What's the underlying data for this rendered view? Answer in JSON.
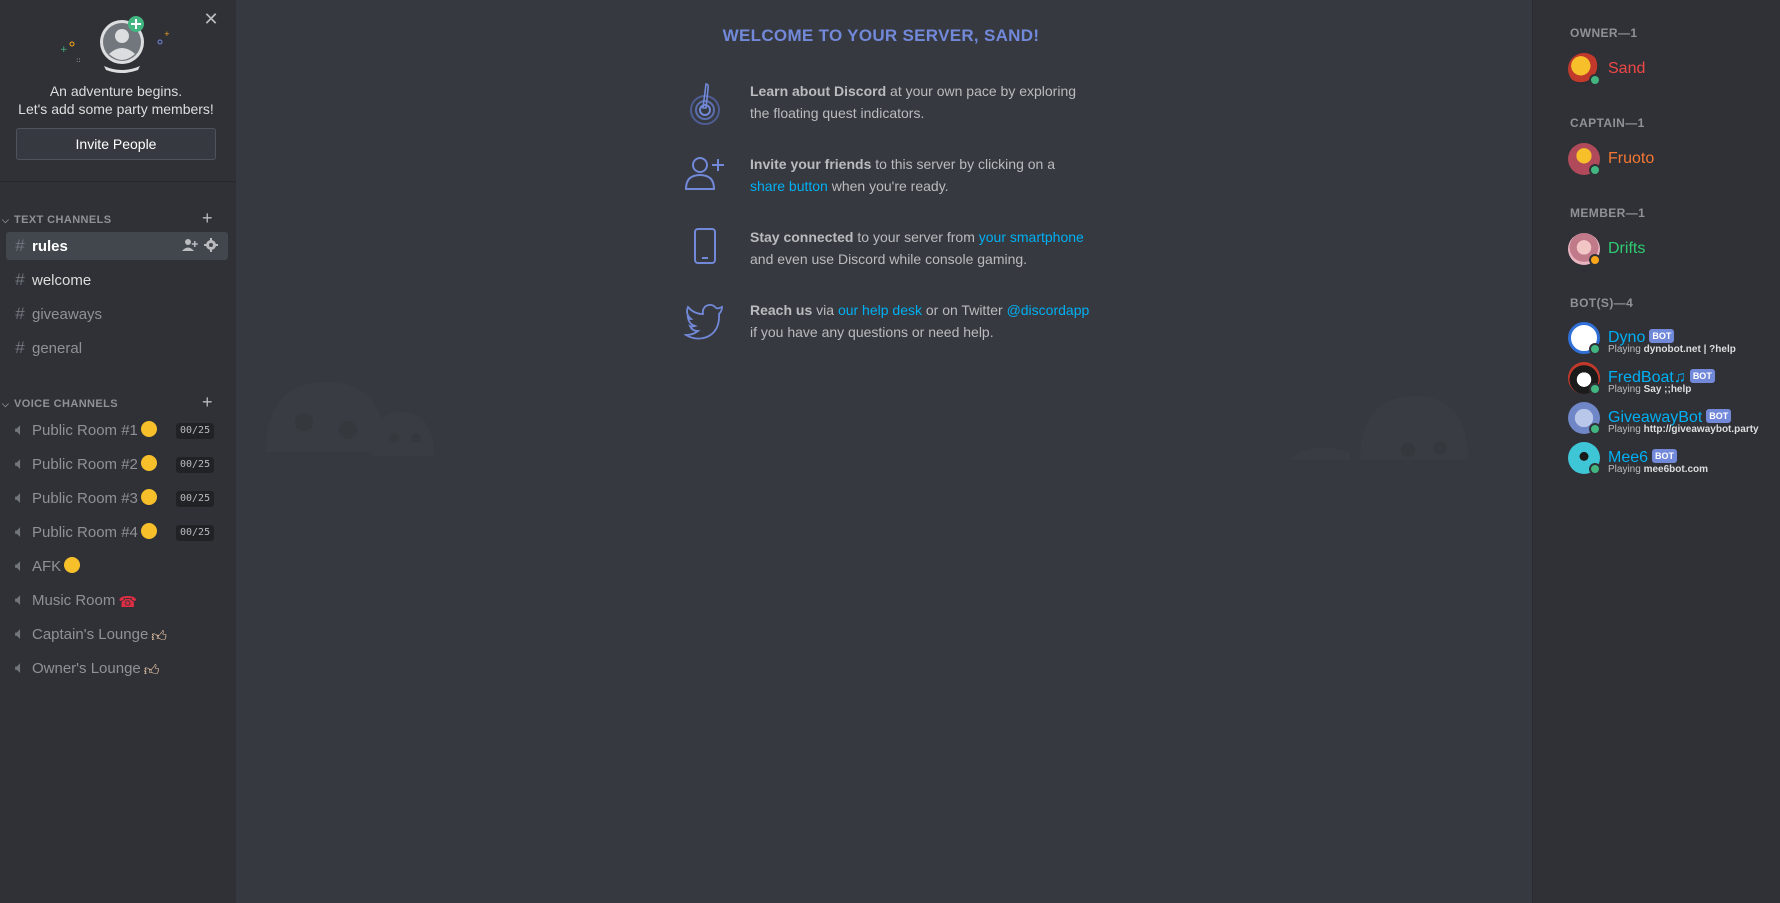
{
  "invite": {
    "line1": "An adventure begins.",
    "line2": "Let's add some party members!",
    "button": "Invite People",
    "close": "✕"
  },
  "text_channels": {
    "header": "TEXT CHANNELS",
    "add": "+",
    "items": [
      {
        "icon": "#",
        "name": "rules"
      },
      {
        "icon": "#",
        "name": "welcome"
      },
      {
        "icon": "#",
        "name": "giveaways"
      },
      {
        "icon": "#",
        "name": "general"
      }
    ]
  },
  "voice_channels": {
    "header": "VOICE CHANNELS",
    "add": "+",
    "items": [
      {
        "name": "Public Room #1",
        "limit": "00/25"
      },
      {
        "name": "Public Room #2",
        "limit": "00/25"
      },
      {
        "name": "Public Room #3",
        "limit": "00/25"
      },
      {
        "name": "Public Room #4",
        "limit": "00/25"
      },
      {
        "name": "AFK"
      },
      {
        "name": "Music Room"
      },
      {
        "name": "Captain's Lounge"
      },
      {
        "name": "Owner's Lounge"
      }
    ]
  },
  "welcome": {
    "title": "WELCOME TO YOUR SERVER, SAND!",
    "tips": [
      {
        "bold": "Learn about Discord",
        "text": " at your own pace by exploring the floating quest indicators."
      },
      {
        "bold": "Invite your friends",
        "text1": " to this server by clicking on a ",
        "link": "share button",
        "text2": " when you're ready."
      },
      {
        "bold": "Stay connected",
        "text1": " to your server from ",
        "link": "your smartphone",
        "text2": " and even use Discord while console gaming."
      },
      {
        "bold": "Reach us",
        "text1": " via ",
        "link": "our help desk",
        "text2": " or on Twitter ",
        "link2": "@discordapp",
        "text3": " if you have any questions or need help."
      }
    ]
  },
  "members": {
    "roles": [
      {
        "header": "OWNER—1"
      },
      {
        "header": "CAPTAIN—1"
      },
      {
        "header": "MEMBER—1"
      },
      {
        "header": "BOT(S)—4"
      }
    ],
    "list": [
      {
        "name": "Sand",
        "color": "#f04747",
        "status": "online"
      },
      {
        "name": "Fruoto",
        "color": "#f57731",
        "status": "online"
      },
      {
        "name": "Drifts",
        "color": "#2ecc71",
        "status": "idle"
      },
      {
        "name": "Dyno",
        "color": "#00b0f4",
        "bot": "BOT",
        "playing": "Playing",
        "game": "dynobot.net | ?help",
        "status": "online"
      },
      {
        "name": "FredBoat♫",
        "color": "#00b0f4",
        "bot": "BOT",
        "playing": "Playing",
        "game": "Say ;;help",
        "status": "online"
      },
      {
        "name": "GiveawayBot",
        "color": "#00b0f4",
        "bot": "BOT",
        "playing": "Playing",
        "game": "http://giveawaybot.party",
        "status": "online"
      },
      {
        "name": "Mee6",
        "color": "#00b0f4",
        "bot": "BOT",
        "playing": "Playing",
        "game": "mee6bot.com",
        "status": "online"
      }
    ]
  },
  "colors": {
    "accent": "#7289da",
    "link": "#00b0f4",
    "online": "#43b581",
    "idle": "#faa61a"
  }
}
